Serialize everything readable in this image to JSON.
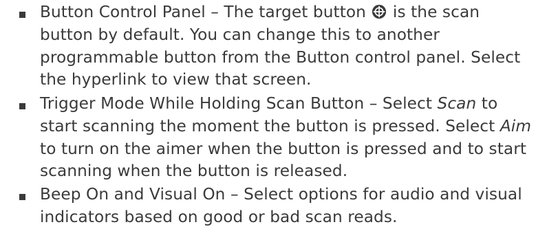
{
  "bullets": [
    {
      "icon": "bullet-square",
      "parts": {
        "a": "Button Control Panel – The target button ",
        "icon": "target-button-icon",
        "b": " is the scan button by default. You can change this to another programmable button from the Button control panel. Select the hyperlink to view that screen."
      }
    },
    {
      "icon": "bullet-square",
      "parts": {
        "a": "Trigger Mode While Holding Scan Button – Select ",
        "scan": "Scan",
        "b": " to start scanning the moment the button is pressed. Select ",
        "aim": "Aim",
        "c": " to turn on the aimer when the button is pressed and to start scanning when the button is released."
      }
    },
    {
      "icon": "bullet-square",
      "parts": {
        "a": "Beep On and Visual On – Select options for audio and visual indicators based on good or bad scan reads."
      }
    }
  ],
  "colors": {
    "text": "#3a3a3a",
    "bullet": "#3a3a3a"
  }
}
